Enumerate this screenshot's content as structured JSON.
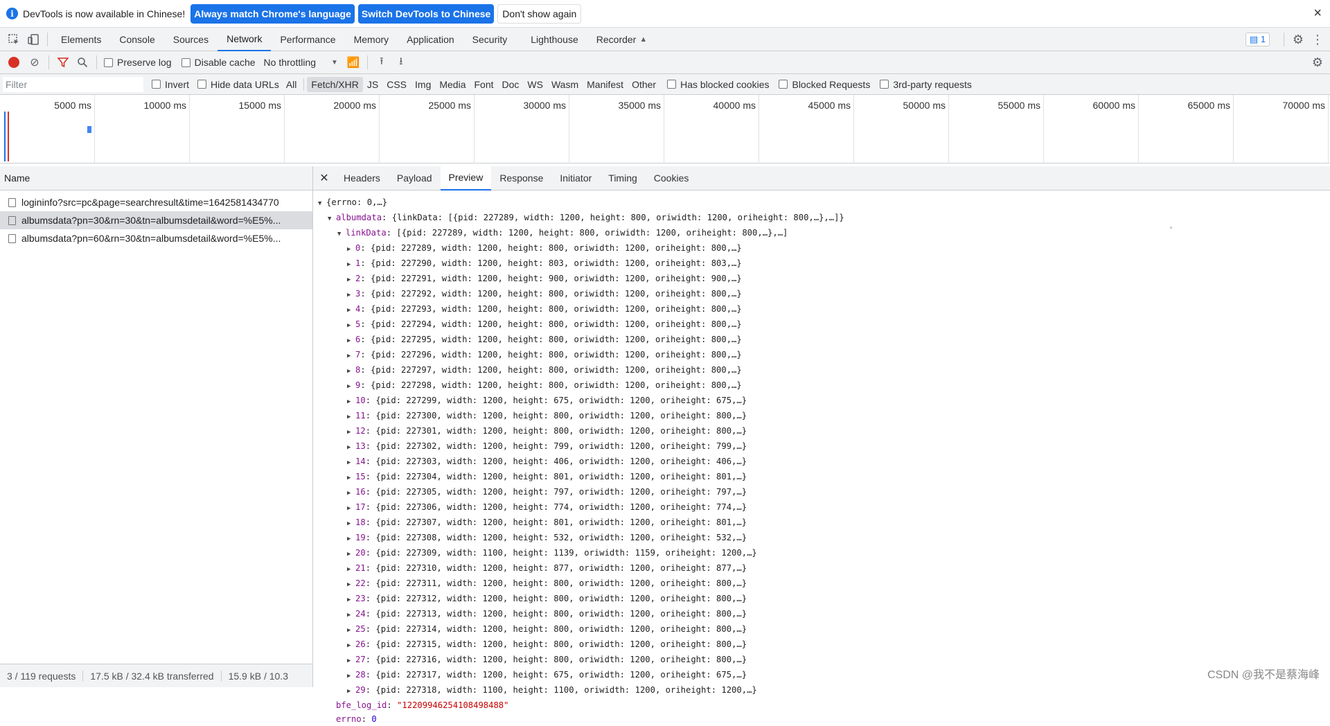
{
  "infobar": {
    "message": "DevTools is now available in Chinese!",
    "btn_match": "Always match Chrome's language",
    "btn_switch": "Switch DevTools to Chinese",
    "btn_dismiss": "Don't show again",
    "close": "×"
  },
  "main_tabs": [
    "Elements",
    "Console",
    "Sources",
    "Network",
    "Performance",
    "Memory",
    "Application",
    "Security",
    "Lighthouse",
    "Recorder"
  ],
  "active_main_tab": "Network",
  "issues_count": "1",
  "toolbar": {
    "preserve_log": "Preserve log",
    "disable_cache": "Disable cache",
    "throttling": "No throttling"
  },
  "filterbar": {
    "placeholder": "Filter",
    "invert": "Invert",
    "hide_data_urls": "Hide data URLs",
    "types": [
      "All",
      "Fetch/XHR",
      "JS",
      "CSS",
      "Img",
      "Media",
      "Font",
      "Doc",
      "WS",
      "Wasm",
      "Manifest",
      "Other"
    ],
    "active_type": "Fetch/XHR",
    "blocked_cookies": "Has blocked cookies",
    "blocked_requests": "Blocked Requests",
    "third_party": "3rd-party requests"
  },
  "overview_ticks": [
    "5000 ms",
    "10000 ms",
    "15000 ms",
    "20000 ms",
    "25000 ms",
    "30000 ms",
    "35000 ms",
    "40000 ms",
    "45000 ms",
    "50000 ms",
    "55000 ms",
    "60000 ms",
    "65000 ms",
    "70000 ms"
  ],
  "requests": {
    "header": "Name",
    "items": [
      "logininfo?src=pc&page=searchresult&time=1642581434770",
      "albumsdata?pn=30&rn=30&tn=albumsdetail&word=%E5%...",
      "albumsdata?pn=60&rn=30&tn=albumsdetail&word=%E5%..."
    ]
  },
  "status": {
    "requests": "3 / 119 requests",
    "transferred": "17.5 kB / 32.4 kB transferred",
    "resources": "15.9 kB / 10.3"
  },
  "detail_tabs": [
    "Headers",
    "Payload",
    "Preview",
    "Response",
    "Initiator",
    "Timing",
    "Cookies"
  ],
  "active_detail_tab": "Preview",
  "preview": {
    "root": "{errno: 0,…}",
    "albumdata_key": "albumdata",
    "albumdata_summary": "{linkData: [{pid: 227289, width: 1200, height: 800, oriwidth: 1200, oriheight: 800,…},…]}",
    "linkdata_key": "linkData",
    "linkdata_summary": "[{pid: 227289, width: 1200, height: 800, oriwidth: 1200, oriheight: 800,…},…]",
    "items": [
      {
        "i": "0",
        "pid": 227289,
        "width": 1200,
        "height": 800,
        "oriwidth": 1200,
        "oriheight": 800
      },
      {
        "i": "1",
        "pid": 227290,
        "width": 1200,
        "height": 803,
        "oriwidth": 1200,
        "oriheight": 803
      },
      {
        "i": "2",
        "pid": 227291,
        "width": 1200,
        "height": 900,
        "oriwidth": 1200,
        "oriheight": 900
      },
      {
        "i": "3",
        "pid": 227292,
        "width": 1200,
        "height": 800,
        "oriwidth": 1200,
        "oriheight": 800
      },
      {
        "i": "4",
        "pid": 227293,
        "width": 1200,
        "height": 800,
        "oriwidth": 1200,
        "oriheight": 800
      },
      {
        "i": "5",
        "pid": 227294,
        "width": 1200,
        "height": 800,
        "oriwidth": 1200,
        "oriheight": 800
      },
      {
        "i": "6",
        "pid": 227295,
        "width": 1200,
        "height": 800,
        "oriwidth": 1200,
        "oriheight": 800
      },
      {
        "i": "7",
        "pid": 227296,
        "width": 1200,
        "height": 800,
        "oriwidth": 1200,
        "oriheight": 800
      },
      {
        "i": "8",
        "pid": 227297,
        "width": 1200,
        "height": 800,
        "oriwidth": 1200,
        "oriheight": 800
      },
      {
        "i": "9",
        "pid": 227298,
        "width": 1200,
        "height": 800,
        "oriwidth": 1200,
        "oriheight": 800
      },
      {
        "i": "10",
        "pid": 227299,
        "width": 1200,
        "height": 675,
        "oriwidth": 1200,
        "oriheight": 675
      },
      {
        "i": "11",
        "pid": 227300,
        "width": 1200,
        "height": 800,
        "oriwidth": 1200,
        "oriheight": 800
      },
      {
        "i": "12",
        "pid": 227301,
        "width": 1200,
        "height": 800,
        "oriwidth": 1200,
        "oriheight": 800
      },
      {
        "i": "13",
        "pid": 227302,
        "width": 1200,
        "height": 799,
        "oriwidth": 1200,
        "oriheight": 799
      },
      {
        "i": "14",
        "pid": 227303,
        "width": 1200,
        "height": 406,
        "oriwidth": 1200,
        "oriheight": 406
      },
      {
        "i": "15",
        "pid": 227304,
        "width": 1200,
        "height": 801,
        "oriwidth": 1200,
        "oriheight": 801
      },
      {
        "i": "16",
        "pid": 227305,
        "width": 1200,
        "height": 797,
        "oriwidth": 1200,
        "oriheight": 797
      },
      {
        "i": "17",
        "pid": 227306,
        "width": 1200,
        "height": 774,
        "oriwidth": 1200,
        "oriheight": 774
      },
      {
        "i": "18",
        "pid": 227307,
        "width": 1200,
        "height": 801,
        "oriwidth": 1200,
        "oriheight": 801
      },
      {
        "i": "19",
        "pid": 227308,
        "width": 1200,
        "height": 532,
        "oriwidth": 1200,
        "oriheight": 532
      },
      {
        "i": "20",
        "pid": 227309,
        "width": 1100,
        "height": 1139,
        "oriwidth": 1159,
        "oriheight": 1200
      },
      {
        "i": "21",
        "pid": 227310,
        "width": 1200,
        "height": 877,
        "oriwidth": 1200,
        "oriheight": 877
      },
      {
        "i": "22",
        "pid": 227311,
        "width": 1200,
        "height": 800,
        "oriwidth": 1200,
        "oriheight": 800
      },
      {
        "i": "23",
        "pid": 227312,
        "width": 1200,
        "height": 800,
        "oriwidth": 1200,
        "oriheight": 800
      },
      {
        "i": "24",
        "pid": 227313,
        "width": 1200,
        "height": 800,
        "oriwidth": 1200,
        "oriheight": 800
      },
      {
        "i": "25",
        "pid": 227314,
        "width": 1200,
        "height": 800,
        "oriwidth": 1200,
        "oriheight": 800
      },
      {
        "i": "26",
        "pid": 227315,
        "width": 1200,
        "height": 800,
        "oriwidth": 1200,
        "oriheight": 800
      },
      {
        "i": "27",
        "pid": 227316,
        "width": 1200,
        "height": 800,
        "oriwidth": 1200,
        "oriheight": 800
      },
      {
        "i": "28",
        "pid": 227317,
        "width": 1200,
        "height": 675,
        "oriwidth": 1200,
        "oriheight": 675
      },
      {
        "i": "29",
        "pid": 227318,
        "width": 1100,
        "height": 1100,
        "oriwidth": 1200,
        "oriheight": 1200
      }
    ],
    "bfe_key": "bfe_log_id",
    "bfe_value": "\"12209946254108498488\"",
    "errno_key": "errno",
    "errno_value": "0"
  },
  "watermark": "CSDN @我不是蔡海峰",
  "colors": {
    "accent": "#1a73e8",
    "record": "#d93025",
    "json_key": "#881391",
    "json_string": "#c80000",
    "json_number": "#1c00cf"
  }
}
